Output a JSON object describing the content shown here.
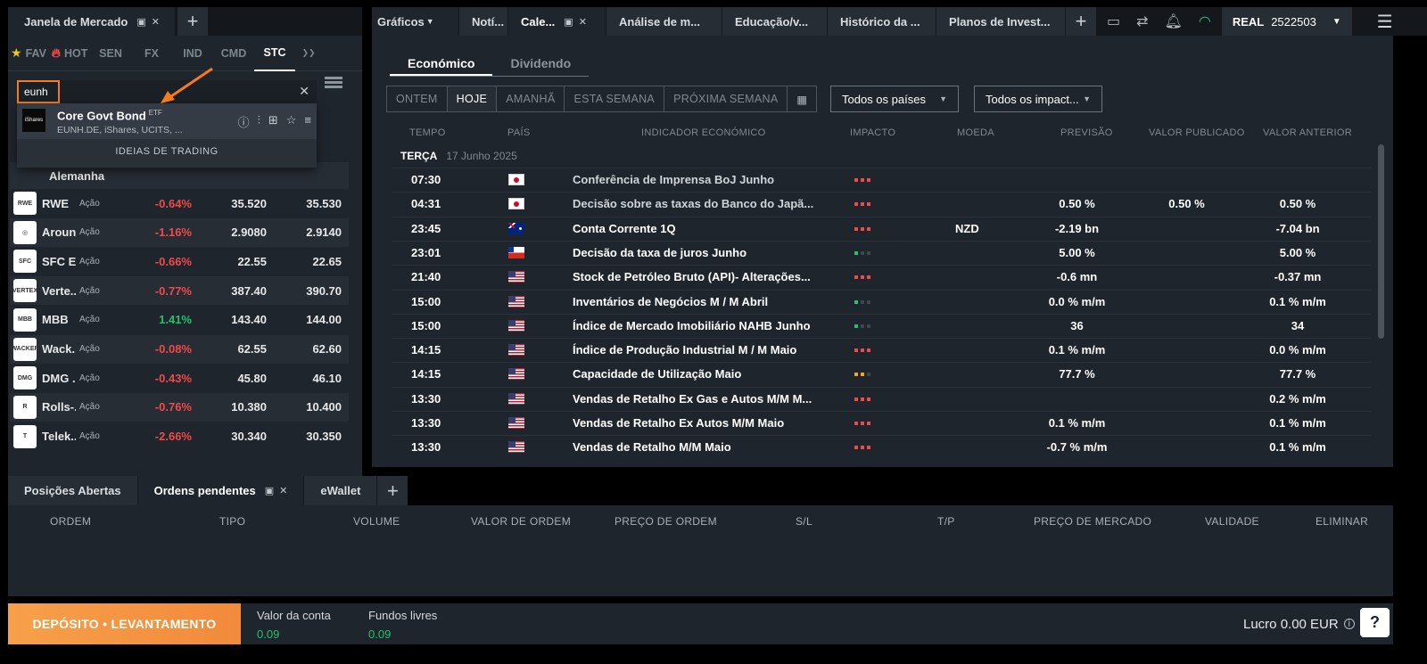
{
  "market": {
    "title": "Janela de Mercado",
    "categories": [
      {
        "label": "FAV",
        "icon": "star-icon"
      },
      {
        "label": "HOT",
        "icon": "flame-icon"
      },
      {
        "label": "SEN",
        "icon": ""
      },
      {
        "label": "FX",
        "icon": ""
      },
      {
        "label": "IND",
        "icon": ""
      },
      {
        "label": "CMD",
        "icon": ""
      },
      {
        "label": "STC",
        "icon": ""
      }
    ],
    "search_value": "eunh",
    "search_result": {
      "name": "Core Govt Bond",
      "tag": "ETF",
      "sub": "EUNH.DE, iShares, UCITS, ...",
      "logo": "iShares"
    },
    "ideas_label": "IDEIAS DE TRADING",
    "group": "Alemanha",
    "rows": [
      {
        "logo": "RWE",
        "name": "RWE",
        "type": "Ação",
        "change": "-0.64%",
        "bid": "35.520",
        "ask": "35.530"
      },
      {
        "logo": "◎",
        "name": "Aroun...",
        "type": "Ação",
        "change": "-1.16%",
        "bid": "2.9080",
        "ask": "2.9140"
      },
      {
        "logo": "SFC",
        "name": "SFC E...",
        "type": "Ação",
        "change": "-0.66%",
        "bid": "22.55",
        "ask": "22.65"
      },
      {
        "logo": "VERTEX",
        "name": "Verte...",
        "type": "Ação",
        "change": "-0.77%",
        "bid": "387.40",
        "ask": "390.70"
      },
      {
        "logo": "MBB",
        "name": "MBB",
        "type": "Ação",
        "change": "1.41%",
        "bid": "143.40",
        "ask": "144.00"
      },
      {
        "logo": "WACKER",
        "name": "Wack...",
        "type": "Ação",
        "change": "-0.08%",
        "bid": "62.55",
        "ask": "62.60"
      },
      {
        "logo": "DMG",
        "name": "DMG ...",
        "type": "Ação",
        "change": "-0.43%",
        "bid": "45.80",
        "ask": "46.10"
      },
      {
        "logo": "R",
        "name": "Rolls-...",
        "type": "Ação",
        "change": "-0.76%",
        "bid": "10.380",
        "ask": "10.400"
      },
      {
        "logo": "T",
        "name": "Telek...",
        "type": "Ação",
        "change": "-2.66%",
        "bid": "30.340",
        "ask": "30.350"
      }
    ]
  },
  "topbar": {
    "tabs": [
      "Gráficos",
      "Notí...",
      "Cale...",
      "Análise de m...",
      "Educação/v...",
      "Histórico da ...",
      "Planos de Invest..."
    ],
    "account_type": "REAL",
    "account_number": "2522503"
  },
  "calendar": {
    "subtabs": [
      "Económico",
      "Dividendo"
    ],
    "day_buttons": [
      "ONTEM",
      "HOJE",
      "AMANHÃ",
      "ESTA SEMANA",
      "PRÓXIMA SEMANA"
    ],
    "country_filter": "Todos os países",
    "impact_filter": "Todos os impact...",
    "columns": [
      "TEMPO",
      "PAÍS",
      "INDICADOR ECONÓMICO",
      "IMPACTO",
      "MOEDA",
      "PREVISÃO",
      "VALOR PUBLICADO",
      "VALOR ANTERIOR"
    ],
    "day_label": "TERÇA",
    "day_date": "17 Junho 2025",
    "rows": [
      {
        "time": "07:30",
        "flag": "jp",
        "indicator": "Conferência de Imprensa BoJ Junho",
        "impact": "high",
        "currency": "",
        "forecast": "",
        "published": "",
        "previous": "",
        "dim": true
      },
      {
        "time": "04:31",
        "flag": "jp",
        "indicator": "Decisão sobre as taxas do Banco do Japã...",
        "impact": "high",
        "currency": "",
        "forecast": "0.50 %",
        "published": "0.50 %",
        "previous": "0.50 %",
        "dim": true
      },
      {
        "time": "23:45",
        "flag": "au",
        "indicator": "Conta Corrente 1Q",
        "impact": "high",
        "currency": "NZD",
        "forecast": "-2.19 bn",
        "published": "",
        "previous": "-7.04 bn",
        "dim": false
      },
      {
        "time": "23:01",
        "flag": "cl",
        "indicator": "Decisão da taxa de juros Junho",
        "impact": "low",
        "currency": "",
        "forecast": "5.00 %",
        "published": "",
        "previous": "5.00 %",
        "dim": false
      },
      {
        "time": "21:40",
        "flag": "us",
        "indicator": "Stock de Petróleo Bruto (API)- Alterações...",
        "impact": "high",
        "currency": "",
        "forecast": "-0.6 mn",
        "published": "",
        "previous": "-0.37 mn",
        "dim": false
      },
      {
        "time": "15:00",
        "flag": "us",
        "indicator": "Inventários de Negócios M / M Abril",
        "impact": "low",
        "currency": "",
        "forecast": "0.0 % m/m",
        "published": "",
        "previous": "0.1 % m/m",
        "dim": false
      },
      {
        "time": "15:00",
        "flag": "us",
        "indicator": "Índice de Mercado Imobiliário NAHB Junho",
        "impact": "low",
        "currency": "",
        "forecast": "36",
        "published": "",
        "previous": "34",
        "dim": false
      },
      {
        "time": "14:15",
        "flag": "us",
        "indicator": "Índice de Produção Industrial M / M Maio",
        "impact": "high",
        "currency": "",
        "forecast": "0.1 % m/m",
        "published": "",
        "previous": "0.0 % m/m",
        "dim": false
      },
      {
        "time": "14:15",
        "flag": "us",
        "indicator": "Capacidade de Utilização Maio",
        "impact": "medium",
        "currency": "",
        "forecast": "77.7 %",
        "published": "",
        "previous": "77.7 %",
        "dim": false
      },
      {
        "time": "13:30",
        "flag": "us",
        "indicator": "Vendas de Retalho Ex Gas e Autos M/M M...",
        "impact": "high",
        "currency": "",
        "forecast": "",
        "published": "",
        "previous": "0.2 % m/m",
        "dim": false
      },
      {
        "time": "13:30",
        "flag": "us",
        "indicator": "Vendas de Retalho Ex Autos M/M Maio",
        "impact": "high",
        "currency": "",
        "forecast": "0.1 % m/m",
        "published": "",
        "previous": "0.1 % m/m",
        "dim": false
      },
      {
        "time": "13:30",
        "flag": "us",
        "indicator": "Vendas de Retalho M/M Maio",
        "impact": "high",
        "currency": "",
        "forecast": "-0.7 % m/m",
        "published": "",
        "previous": "0.1 % m/m",
        "dim": false
      }
    ]
  },
  "orders": {
    "tabs": [
      "Posições Abertas",
      "Ordens pendentes",
      "eWallet"
    ],
    "columns": [
      "ORDEM",
      "TIPO",
      "VOLUME",
      "VALOR DE ORDEM",
      "PREÇO DE ORDEM",
      "S/L",
      "T/P",
      "PREÇO DE MERCADO",
      "VALIDADE",
      "ELIMINAR"
    ]
  },
  "footer": {
    "deposit_label": "DEPÓSITO • LEVANTAMENTO",
    "account_value_label": "Valor da conta",
    "account_value": "0.09",
    "free_funds_label": "Fundos livres",
    "free_funds": "0.09",
    "profit": "Lucro 0.00 EUR",
    "help": "?"
  },
  "colors": {
    "impact_red": "#ef4a4a",
    "impact_green": "#23c26b",
    "impact_orange": "#f5a623",
    "impact_off": "#3d454d",
    "accent_orange": "#f47b20"
  }
}
